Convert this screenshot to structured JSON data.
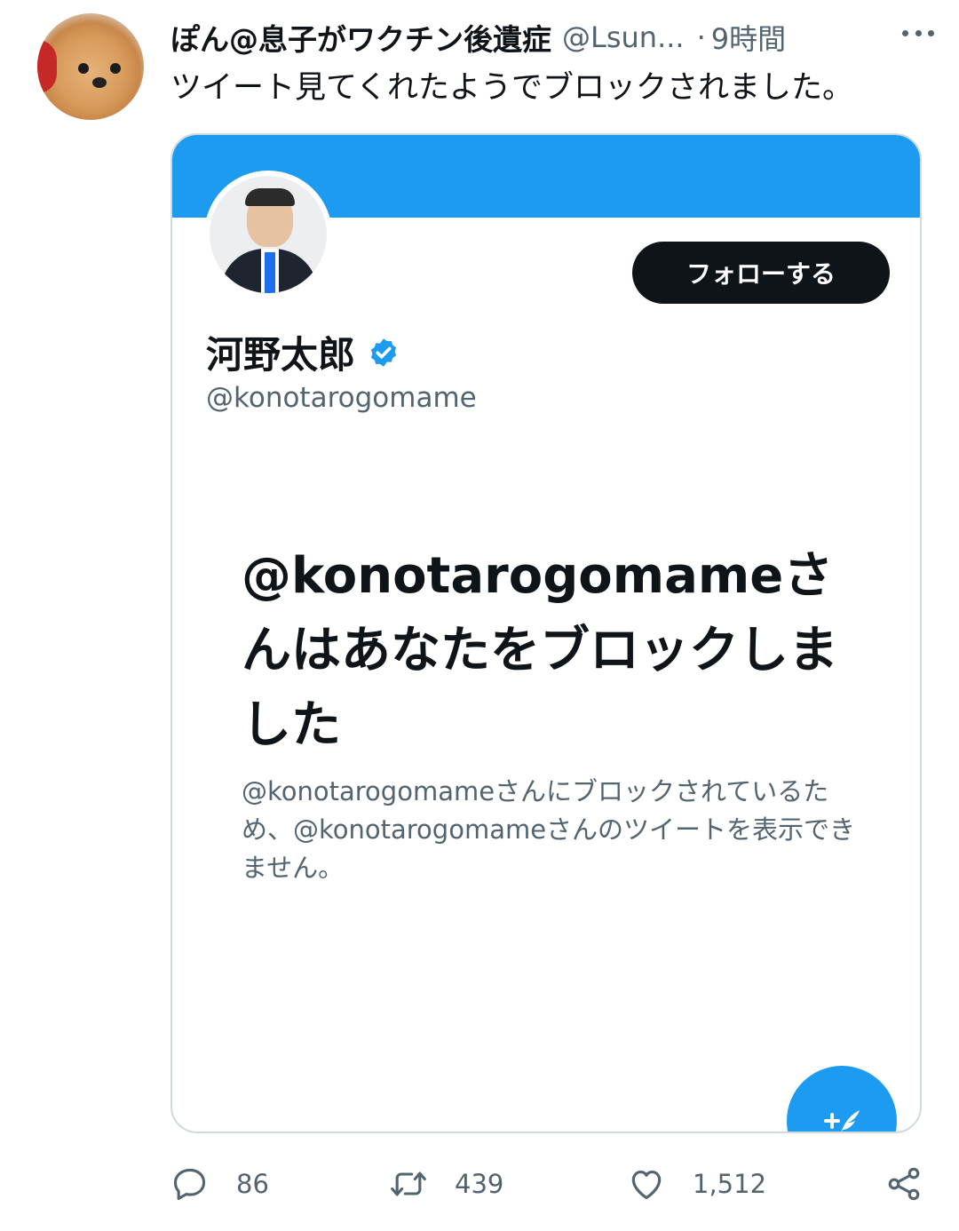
{
  "tweet": {
    "author_name": "ぽん@息子がワクチン後遺症",
    "author_handle": "@Lsun...",
    "separator": "·",
    "time": "9時間",
    "text": "ツイート見てくれたようでブロックされました。"
  },
  "screenshot_card": {
    "follow_label": "フォローする",
    "profile_name": "河野太郎",
    "profile_handle": "@konotarogomame",
    "block_title": "@konotarogomameさんはあなたをブロックしました",
    "block_description": "@konotarogomameさんにブロックされているため、@konotarogomameさんのツイートを表示できません。",
    "fab_label": "+"
  },
  "actions": {
    "reply_count": "86",
    "retweet_count": "439",
    "like_count": "1,512"
  },
  "colors": {
    "accent": "#1d9bf0",
    "text_primary": "#0f1419",
    "text_secondary": "#536471",
    "border": "#cfd9de"
  },
  "icons": [
    "more-icon",
    "verified-icon",
    "compose-icon",
    "reply-icon",
    "retweet-icon",
    "like-icon",
    "share-icon"
  ]
}
